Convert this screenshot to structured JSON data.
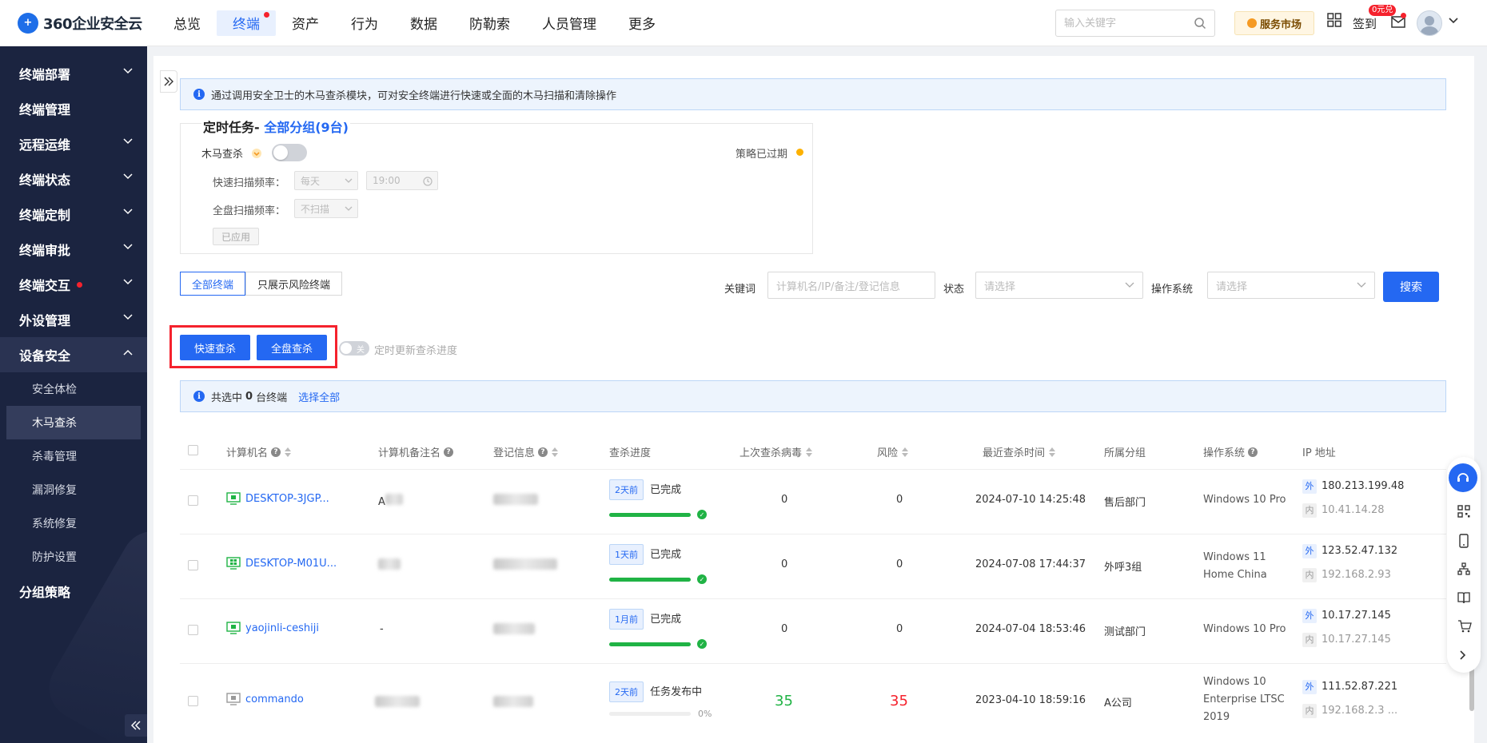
{
  "app": {
    "logo_text": "360企业安全云",
    "logo_mark": "+"
  },
  "nav": {
    "items": [
      "总览",
      "终端",
      "资产",
      "行为",
      "数据",
      "防勒索",
      "人员管理",
      "更多"
    ]
  },
  "topbar": {
    "search_placeholder": "输入关键字",
    "market": "服务市场",
    "signin": "签到",
    "sign_badge": "0元兑"
  },
  "sidebar": {
    "groups": [
      {
        "label": "终端部署"
      },
      {
        "label": "终端管理"
      },
      {
        "label": "远程运维"
      },
      {
        "label": "终端状态"
      },
      {
        "label": "终端定制"
      },
      {
        "label": "终端审批"
      },
      {
        "label": "终端交互"
      },
      {
        "label": "外设管理"
      },
      {
        "label": "设备安全"
      },
      {
        "label": "分组策略"
      }
    ],
    "sub_items": [
      "安全体检",
      "木马查杀",
      "杀毒管理",
      "漏洞修复",
      "系统修复",
      "防护设置"
    ]
  },
  "notice": "通过调用安全卫士的木马查杀模块，可对安全终端进行快速或全面的木马扫描和清除操作",
  "task": {
    "title": "定时任务- ",
    "group": "全部分组(9台)",
    "trojan_label": "木马查杀",
    "expired": "策略已过期",
    "quick_freq_label": "快速扫描频率：",
    "quick_freq": "每天",
    "quick_time": "19:00",
    "full_freq_label": "全盘扫描频率：",
    "full_freq": "不扫描",
    "applied": "已应用"
  },
  "filter": {
    "tab_all": "全部终端",
    "tab_risk": "只展示风险终端",
    "kw_label": "关键词",
    "kw_placeholder": "计算机名/IP/备注/登记信息",
    "status_label": "状态",
    "status_placeholder": "请选择",
    "os_label": "操作系统",
    "os_placeholder": "请选择",
    "search_btn": "搜索"
  },
  "actions": {
    "quick": "快速查杀",
    "full": "全盘查杀",
    "toggle": "关",
    "auto_update": "定时更新查杀进度"
  },
  "selection": {
    "prefix": "共选中",
    "count": "0",
    "suffix": "台终端",
    "select_all": "选择全部"
  },
  "table": {
    "headers": {
      "name": "计算机名",
      "remark": "计算机备注名",
      "reg": "登记信息",
      "progress": "查杀进度",
      "last_virus": "上次查杀病毒",
      "risk": "风险",
      "last_time": "最近查杀时间",
      "group": "所属分组",
      "os": "操作系统",
      "ip": "IP 地址"
    },
    "rows": [
      {
        "name": "DESKTOP-3JGP...",
        "remark": "A",
        "ago": "2天前",
        "status": "已完成",
        "progress": 1.0,
        "virus": "0",
        "risk": "0",
        "time": "2024-07-10 14:25:48",
        "group": "售后部门",
        "os": "Windows 10 Pro",
        "ip_out": "180.213.199.48",
        "ip_in": "10.41.14.28"
      },
      {
        "name": "DESKTOP-M01U...",
        "remark": "",
        "ago": "1天前",
        "status": "已完成",
        "progress": 1.0,
        "virus": "0",
        "risk": "0",
        "time": "2024-07-08 17:44:37",
        "group": "外呼3组",
        "os": "Windows 11 Home China",
        "ip_out": "123.52.47.132",
        "ip_in": "192.168.2.93"
      },
      {
        "name": "yaojinli-ceshiji",
        "remark": "-",
        "ago": "1月前",
        "status": "已完成",
        "progress": 1.0,
        "virus": "0",
        "risk": "0",
        "time": "2024-07-04 18:53:46",
        "group": "测试部门",
        "os": "Windows 10 Pro",
        "ip_out": "10.17.27.145",
        "ip_in": "10.17.27.145"
      },
      {
        "name": "commando",
        "remark": "",
        "ago": "2天前",
        "status": "任务发布中",
        "progress": 0.0,
        "pct": "0%",
        "virus": "35",
        "risk": "35",
        "time": "2023-04-10 18:59:16",
        "group": "A公司",
        "os": "Windows 10 Enterprise LTSC 2019",
        "ip_out": "111.52.87.221",
        "ip_in": "192.168.2.3 ..."
      }
    ],
    "ip_out_tag": "外",
    "ip_in_tag": "内"
  },
  "colors": {
    "accent": "#2468f2",
    "sidebar_bg": "#1b2440",
    "success": "#20b345",
    "danger": "#f5222d"
  }
}
